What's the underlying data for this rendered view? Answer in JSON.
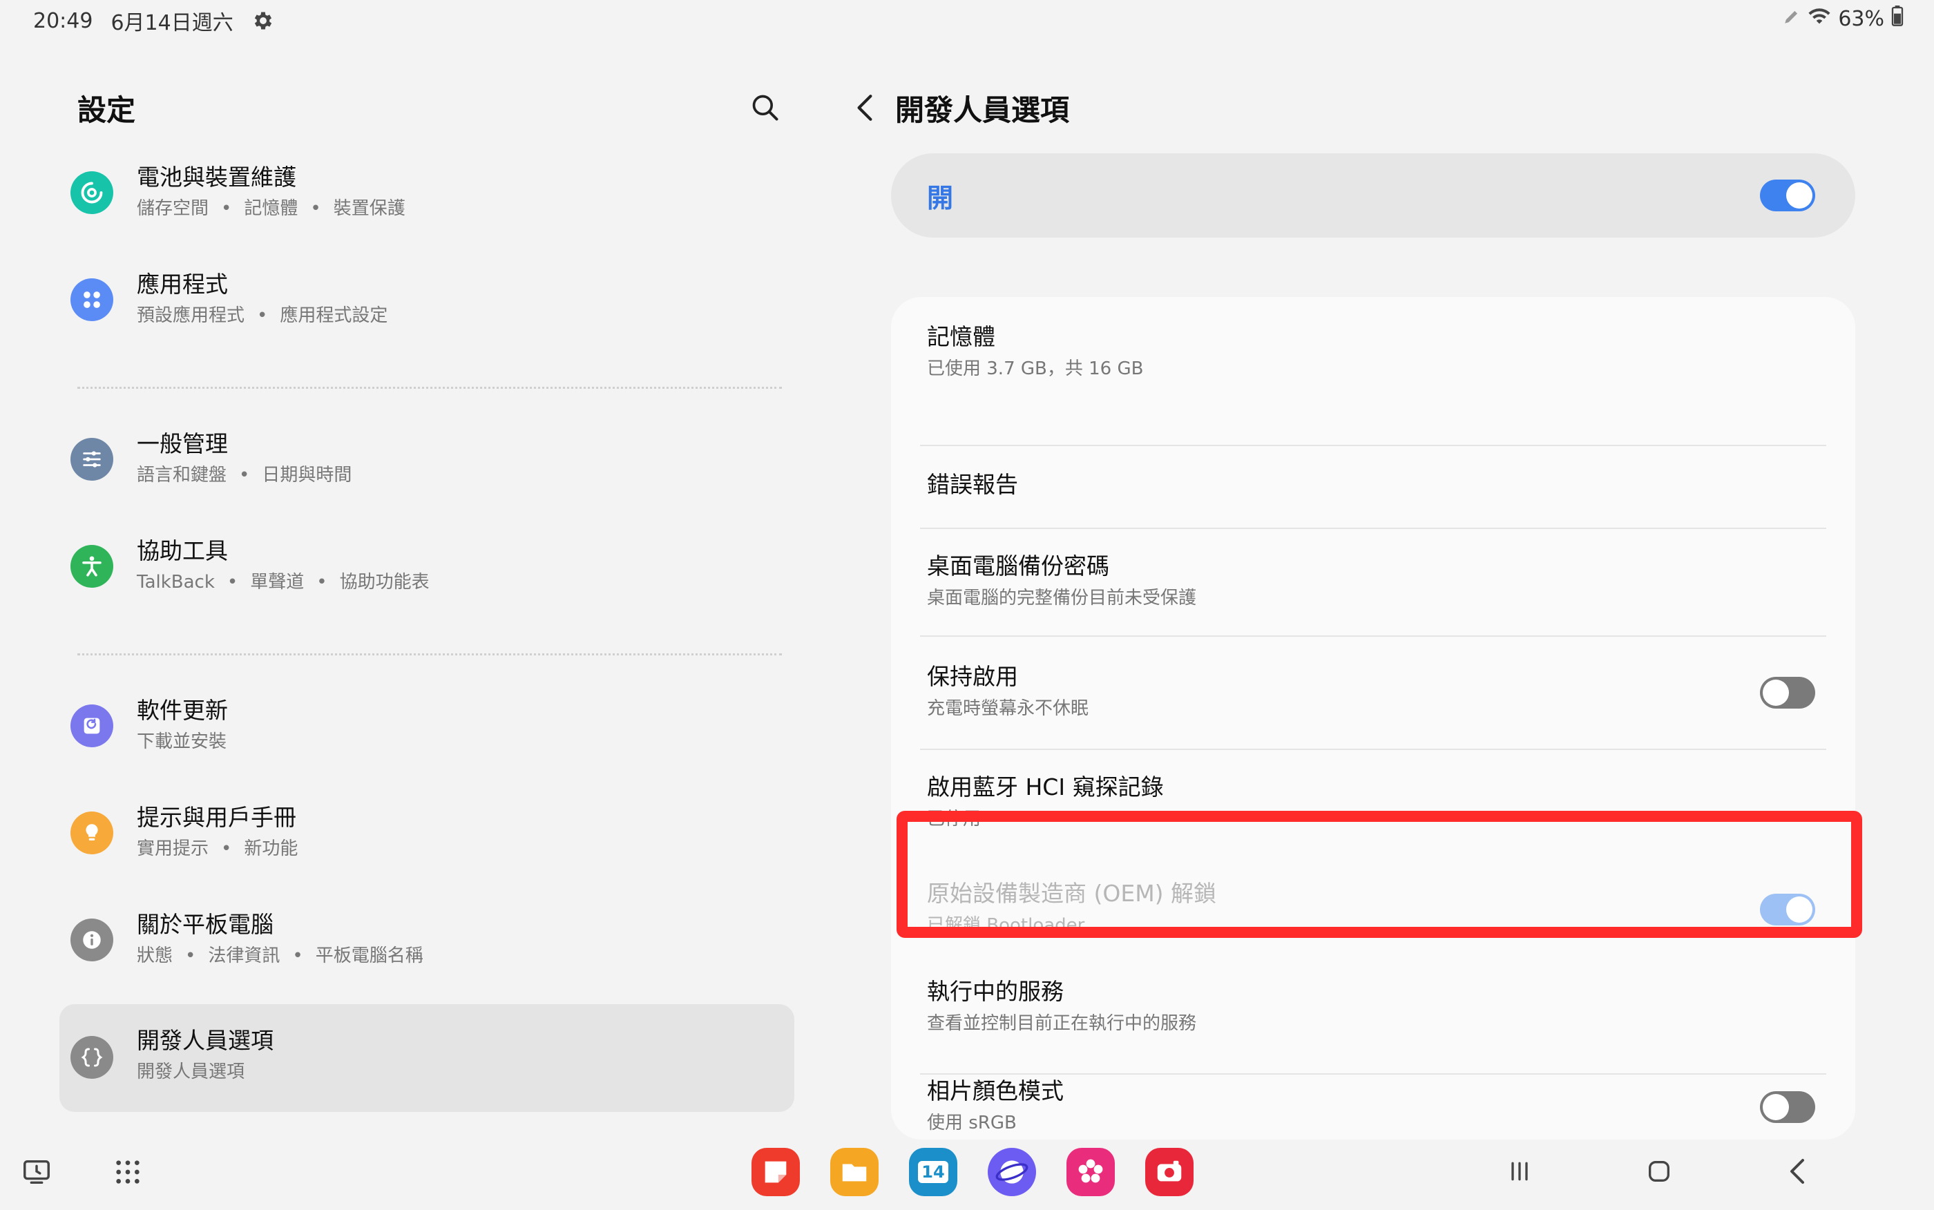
{
  "status_bar": {
    "time": "20:49",
    "date": "6月14日週六",
    "battery": "63%"
  },
  "left": {
    "title": "設定",
    "items": [
      {
        "title": "電池與裝置維護",
        "sub": [
          "儲存空間",
          "記憶體",
          "裝置保護"
        ],
        "icon": "device-care-icon",
        "color": "#17c3a9"
      },
      {
        "title": "應用程式",
        "sub": [
          "預設應用程式",
          "應用程式設定"
        ],
        "icon": "apps-icon",
        "color": "#5b8cf5"
      },
      {
        "title": "一般管理",
        "sub": [
          "語言和鍵盤",
          "日期與時間"
        ],
        "icon": "sliders-icon",
        "color": "#6f87a6"
      },
      {
        "title": "協助工具",
        "sub": [
          "TalkBack",
          "單聲道",
          "協助功能表"
        ],
        "icon": "accessibility-icon",
        "color": "#2fb45a"
      },
      {
        "title": "軟件更新",
        "sub": [
          "下載並安裝"
        ],
        "icon": "update-icon",
        "color": "#7b78ee"
      },
      {
        "title": "提示與用戶手冊",
        "sub": [
          "實用提示",
          "新功能"
        ],
        "icon": "bulb-icon",
        "color": "#f7a93a"
      },
      {
        "title": "關於平板電腦",
        "sub": [
          "狀態",
          "法律資訊",
          "平板電腦名稱"
        ],
        "icon": "info-icon",
        "color": "#8a8a8a"
      },
      {
        "title": "開發人員選項",
        "sub": [
          "開發人員選項"
        ],
        "icon": "developer-braces-icon",
        "color": "#8a8a8a"
      }
    ]
  },
  "right": {
    "title": "開發人員選項",
    "master": {
      "label": "開",
      "state": "on"
    },
    "options": [
      {
        "title": "記憶體",
        "sub": "已使用 3.7 GB，共 16 GB",
        "toggle": null
      },
      {
        "title": "錯誤報告",
        "sub": "",
        "toggle": null
      },
      {
        "title": "桌面電腦備份密碼",
        "sub": "桌面電腦的完整備份目前未受保護",
        "toggle": null
      },
      {
        "title": "保持啟用",
        "sub": "充電時螢幕永不休眠",
        "toggle": "off"
      },
      {
        "title": "啟用藍牙 HCI 窺探記錄",
        "sub": "已停用",
        "toggle": null
      },
      {
        "title": "原始設備製造商 (OEM) 解鎖",
        "sub": "已解鎖 Bootloader",
        "toggle": "on-disabled"
      },
      {
        "title": "執行中的服務",
        "sub": "查看並控制目前正在執行中的服務",
        "toggle": null
      },
      {
        "title": "相片顏色模式",
        "sub": "使用 sRGB",
        "toggle": "off"
      }
    ]
  },
  "dock": {
    "calendar_day": "14"
  },
  "colors": {
    "accent": "#3e82f0",
    "highlight": "#ff2a2a"
  }
}
